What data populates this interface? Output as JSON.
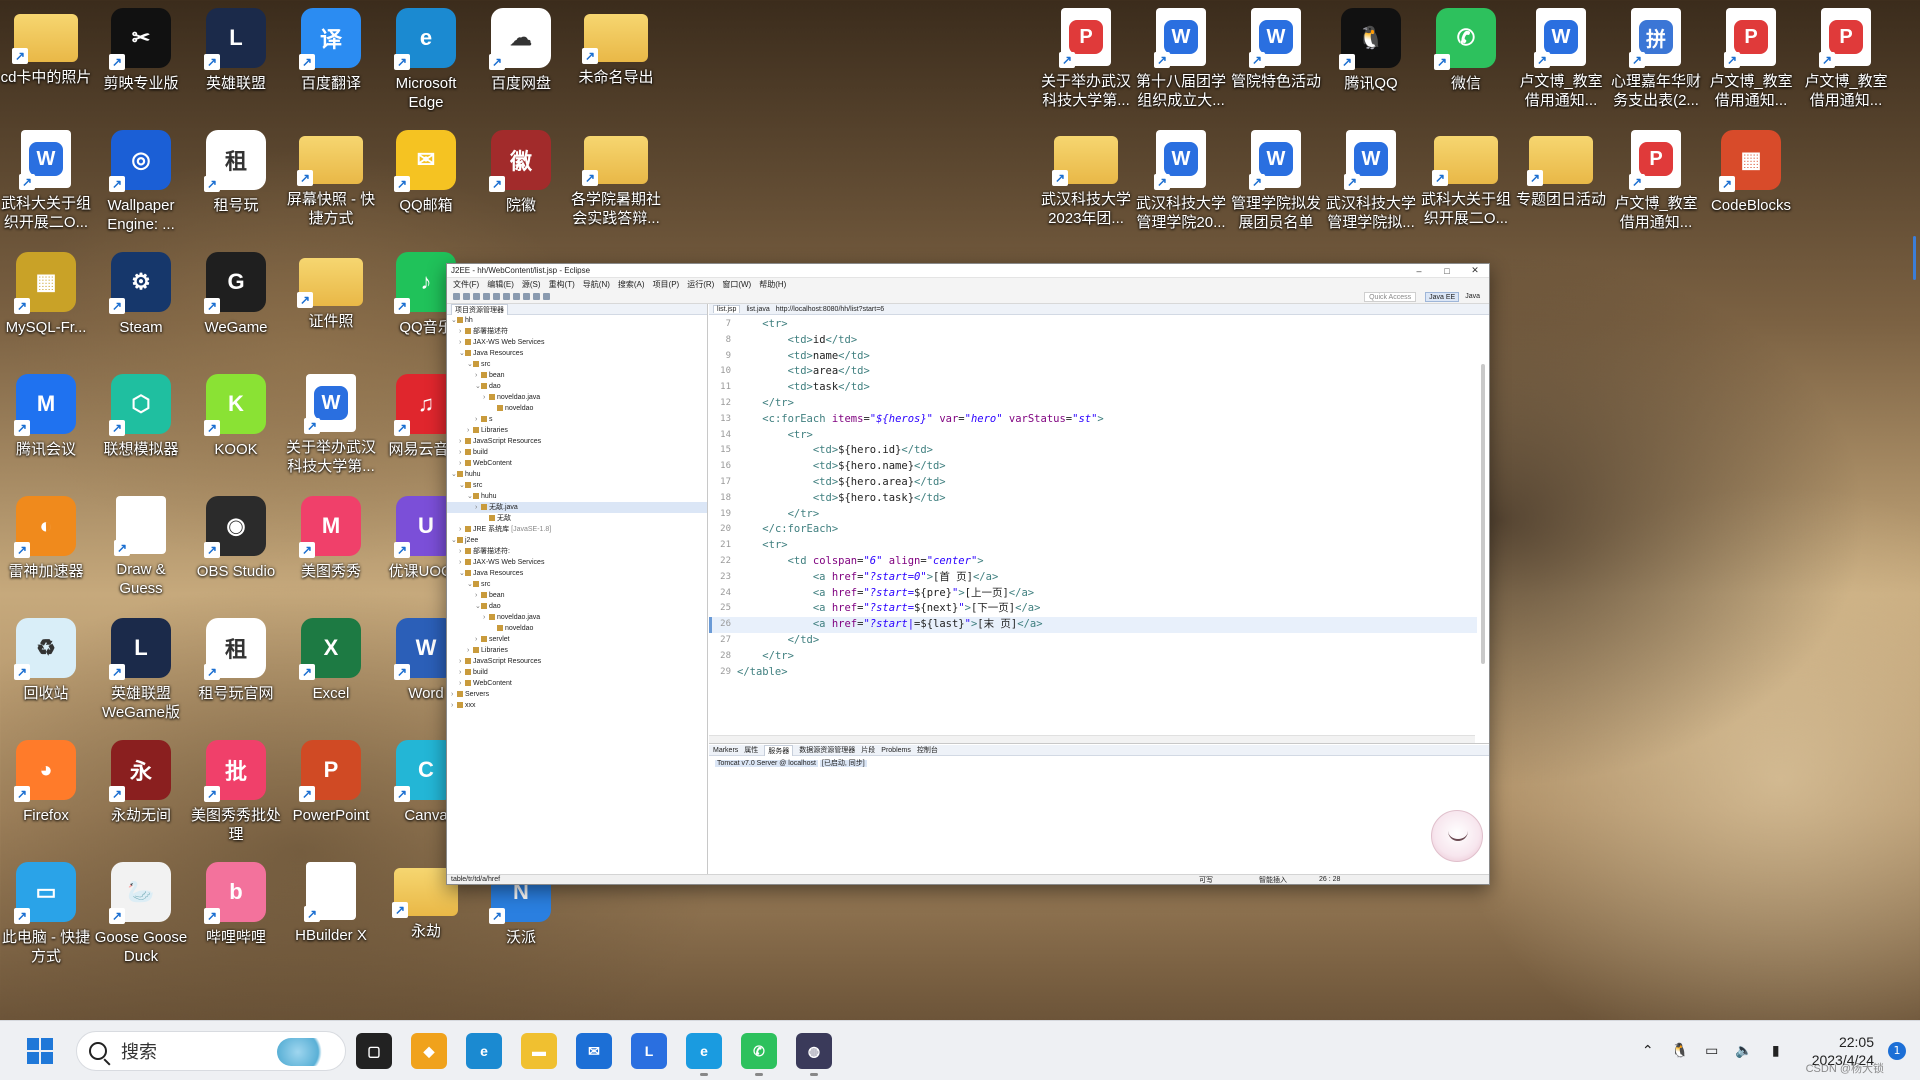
{
  "desktop": {
    "icons": [
      {
        "label": "cd卡中的照片",
        "icon": "photo-folder-icon",
        "color": "#e9b847",
        "kind": "folder"
      },
      {
        "label": "剪映专业版",
        "icon": "capcut-icon",
        "color": "#111111",
        "kind": "app",
        "glyph": "✂"
      },
      {
        "label": "英雄联盟",
        "icon": "league-of-legends-icon",
        "color": "#1b2a4a",
        "kind": "app",
        "glyph": "L"
      },
      {
        "label": "百度翻译",
        "icon": "baidu-translate-icon",
        "color": "#2b8cf2",
        "kind": "app",
        "glyph": "译"
      },
      {
        "label": "Microsoft Edge",
        "icon": "edge-icon",
        "color": "#1b8ad1",
        "kind": "app",
        "glyph": "e"
      },
      {
        "label": "百度网盘",
        "icon": "baidu-netdisk-icon",
        "color": "#ffffff",
        "kind": "app",
        "glyph": "☁"
      },
      {
        "label": "未命名导出",
        "icon": "folder-icon",
        "color": "#e9b847",
        "kind": "folder"
      },
      {
        "label": "武科大关于组织开展二O...",
        "icon": "wps-doc-icon",
        "color": "#2a6fe0",
        "kind": "doc",
        "glyph": "W"
      },
      {
        "label": "Wallpaper Engine: ...",
        "icon": "wallpaper-engine-icon",
        "color": "#1b5fd6",
        "kind": "app",
        "glyph": "◎"
      },
      {
        "label": "租号玩",
        "icon": "zuhaowan-icon",
        "color": "#ffffff",
        "kind": "app",
        "glyph": "租"
      },
      {
        "label": "屏幕快照 - 快捷方式",
        "icon": "screenshot-folder-icon",
        "color": "#e9b847",
        "kind": "folder"
      },
      {
        "label": "QQ邮箱",
        "icon": "qq-mail-icon",
        "color": "#f5c322",
        "kind": "app",
        "glyph": "✉"
      },
      {
        "label": "院徽",
        "icon": "college-emblem-icon",
        "color": "#a22b2b",
        "kind": "app",
        "glyph": "徽"
      },
      {
        "label": "各学院暑期社会实践答辩...",
        "icon": "zip-folder-icon",
        "color": "#e9b847",
        "kind": "folder"
      },
      {
        "label": "MySQL-Fr...",
        "icon": "mysql-icon",
        "color": "#c9a227",
        "kind": "app",
        "glyph": "▦"
      },
      {
        "label": "Steam",
        "icon": "steam-icon",
        "color": "#16376b",
        "kind": "app",
        "glyph": "⚙"
      },
      {
        "label": "WeGame",
        "icon": "wegame-icon",
        "color": "#1f1f1f",
        "kind": "app",
        "glyph": "G"
      },
      {
        "label": "证件照",
        "icon": "id-photo-folder-icon",
        "color": "#e9b847",
        "kind": "folder"
      },
      {
        "label": "QQ音乐",
        "icon": "qq-music-icon",
        "color": "#20c25a",
        "kind": "app",
        "glyph": "♪"
      },
      {
        "label": "腾讯会议",
        "icon": "tencent-meeting-icon",
        "color": "#1f72f0",
        "kind": "app",
        "glyph": "M"
      },
      {
        "label": "联想模拟器",
        "icon": "lenovo-emulator-icon",
        "color": "#1fbfa0",
        "kind": "app",
        "glyph": "⬡"
      },
      {
        "label": "KOOK",
        "icon": "kook-icon",
        "color": "#8ae234",
        "kind": "app",
        "glyph": "K"
      },
      {
        "label": "关于举办武汉科技大学第...",
        "icon": "wps-doc-icon",
        "color": "#2a6fe0",
        "kind": "doc",
        "glyph": "W"
      },
      {
        "label": "网易云音乐",
        "icon": "netease-music-icon",
        "color": "#e0262d",
        "kind": "app",
        "glyph": "♫"
      },
      {
        "label": "雷神加速器",
        "icon": "leishen-accelerator-icon",
        "color": "#f08a1c",
        "kind": "app",
        "glyph": "◐"
      },
      {
        "label": "Draw & Guess",
        "icon": "blank-file-icon",
        "color": "#ffffff",
        "kind": "doc",
        "glyph": ""
      },
      {
        "label": "OBS Studio",
        "icon": "obs-icon",
        "color": "#2b2b2b",
        "kind": "app",
        "glyph": "◉"
      },
      {
        "label": "美图秀秀",
        "icon": "meitu-icon",
        "color": "#f0406a",
        "kind": "app",
        "glyph": "M"
      },
      {
        "label": "优课UOOC",
        "icon": "uooc-icon",
        "color": "#7b4fd8",
        "kind": "app",
        "glyph": "U"
      },
      {
        "label": "回收站",
        "icon": "recycle-bin-icon",
        "color": "#d9eef8",
        "kind": "app",
        "glyph": "♻"
      },
      {
        "label": "英雄联盟WeGame版",
        "icon": "league-of-legends-icon",
        "color": "#1b2a4a",
        "kind": "app",
        "glyph": "L"
      },
      {
        "label": "租号玩官网",
        "icon": "zuhaowan-icon",
        "color": "#ffffff",
        "kind": "app",
        "glyph": "租"
      },
      {
        "label": "Excel",
        "icon": "excel-icon",
        "color": "#1d7a43",
        "kind": "app",
        "glyph": "X"
      },
      {
        "label": "Word",
        "icon": "word-icon",
        "color": "#2b5fb8",
        "kind": "app",
        "glyph": "W"
      },
      {
        "label": "Firefox",
        "icon": "firefox-icon",
        "color": "#ff7b2a",
        "kind": "app",
        "glyph": "◕"
      },
      {
        "label": "永劫无间",
        "icon": "naraka-icon",
        "color": "#8a1f1f",
        "kind": "app",
        "glyph": "永"
      },
      {
        "label": "美图秀秀批处理",
        "icon": "meitu-batch-icon",
        "color": "#f0406a",
        "kind": "app",
        "glyph": "批"
      },
      {
        "label": "PowerPoint",
        "icon": "powerpoint-icon",
        "color": "#d04a24",
        "kind": "app",
        "glyph": "P"
      },
      {
        "label": "Canva",
        "icon": "canva-icon",
        "color": "#23b6d6",
        "kind": "app",
        "glyph": "C"
      },
      {
        "label": "此电脑 - 快捷方式",
        "icon": "this-pc-icon",
        "color": "#2aa3e8",
        "kind": "app",
        "glyph": "▭"
      },
      {
        "label": "Goose Goose Duck",
        "icon": "goose-goose-duck-icon",
        "color": "#f2f2f2",
        "kind": "app",
        "glyph": "🦢"
      },
      {
        "label": "哔哩哔哩",
        "icon": "bilibili-icon",
        "color": "#f3729c",
        "kind": "app",
        "glyph": "b"
      },
      {
        "label": "HBuilder X",
        "icon": "blank-file-icon",
        "color": "#ffffff",
        "kind": "doc",
        "glyph": ""
      },
      {
        "label": "永劫",
        "icon": "folder-icon",
        "color": "#e9b847",
        "kind": "folder"
      },
      {
        "label": "沃派",
        "icon": "wopai-icon",
        "color": "#2a7fe0",
        "kind": "app",
        "glyph": "N"
      },
      {
        "label": "关于举办武汉科技大学第...",
        "icon": "wps-pdf-icon",
        "color": "#e03a3a",
        "kind": "doc",
        "glyph": "P"
      },
      {
        "label": "第十八届团学组织成立大...",
        "icon": "wps-doc-icon",
        "color": "#2a6fe0",
        "kind": "doc",
        "glyph": "W"
      },
      {
        "label": "管院特色活动",
        "icon": "wps-doc-icon",
        "color": "#2a6fe0",
        "kind": "doc",
        "glyph": "W"
      },
      {
        "label": "腾讯QQ",
        "icon": "qq-icon",
        "color": "#111111",
        "kind": "app",
        "glyph": "🐧"
      },
      {
        "label": "微信",
        "icon": "wechat-icon",
        "color": "#2dc15d",
        "kind": "app",
        "glyph": "✆"
      },
      {
        "label": "卢文博_教室借用通知...",
        "icon": "wps-doc-icon",
        "color": "#2a6fe0",
        "kind": "doc",
        "glyph": "W"
      },
      {
        "label": "心理嘉年华财务支出表(2...",
        "icon": "spreadsheet-icon",
        "color": "#3b76d6",
        "kind": "doc",
        "glyph": "拼"
      },
      {
        "label": "卢文博_教室借用通知...",
        "icon": "wps-pdf-icon",
        "color": "#e03a3a",
        "kind": "doc",
        "glyph": "P"
      },
      {
        "label": "卢文博_教室借用通知...",
        "icon": "wps-pdf-icon",
        "color": "#e03a3a",
        "kind": "doc",
        "glyph": "P"
      },
      {
        "label": "武汉科技大学2023年团...",
        "icon": "folder-icon",
        "color": "#e9b847",
        "kind": "folder"
      },
      {
        "label": "武汉科技大学管理学院20...",
        "icon": "wps-doc-icon",
        "color": "#2a6fe0",
        "kind": "doc",
        "glyph": "W"
      },
      {
        "label": "管理学院拟发展团员名单",
        "icon": "wps-doc-icon",
        "color": "#2a6fe0",
        "kind": "doc",
        "glyph": "W"
      },
      {
        "label": "武汉科技大学管理学院拟...",
        "icon": "wps-doc-icon",
        "color": "#2a6fe0",
        "kind": "doc",
        "glyph": "W"
      },
      {
        "label": "武科大关于组织开展二O...",
        "icon": "zip-folder-icon",
        "color": "#e9b847",
        "kind": "folder"
      },
      {
        "label": "专题团日活动",
        "icon": "zip-folder-icon",
        "color": "#e9b847",
        "kind": "folder"
      },
      {
        "label": "卢文博_教室借用通知...",
        "icon": "wps-pdf-icon",
        "color": "#e03a3a",
        "kind": "doc",
        "glyph": "P"
      },
      {
        "label": "CodeBlocks",
        "icon": "codeblocks-icon",
        "color": "#d84b2a",
        "kind": "app",
        "glyph": "▦"
      }
    ]
  },
  "eclipse": {
    "title": "J2EE - hh/WebContent/list.jsp - Eclipse",
    "menu": [
      "文件(F)",
      "编辑(E)",
      "源(S)",
      "重构(T)",
      "导航(N)",
      "搜索(A)",
      "项目(P)",
      "运行(R)",
      "窗口(W)",
      "帮助(H)"
    ],
    "quick_access": "Quick Access",
    "perspectives": [
      "Java EE",
      "Java"
    ],
    "explorer_tab": "项目资源管理器",
    "tree": [
      {
        "text": "hh",
        "indent": 0,
        "twisty": "⌄"
      },
      {
        "text": "部署描述符",
        "indent": 1,
        "twisty": "›"
      },
      {
        "text": "JAX-WS Web Services",
        "indent": 1,
        "twisty": "›"
      },
      {
        "text": "Java Resources",
        "indent": 1,
        "twisty": "⌄"
      },
      {
        "text": "src",
        "indent": 2,
        "twisty": "⌄"
      },
      {
        "text": "bean",
        "indent": 3,
        "twisty": "›"
      },
      {
        "text": "dao",
        "indent": 3,
        "twisty": "⌄"
      },
      {
        "text": "noveldao.java",
        "indent": 4,
        "twisty": "›"
      },
      {
        "text": "noveldao",
        "indent": 5,
        "twisty": ""
      },
      {
        "text": "s",
        "indent": 3,
        "twisty": "›"
      },
      {
        "text": "Libraries",
        "indent": 2,
        "twisty": "›"
      },
      {
        "text": "JavaScript Resources",
        "indent": 1,
        "twisty": "›"
      },
      {
        "text": "build",
        "indent": 1,
        "twisty": "›"
      },
      {
        "text": "WebContent",
        "indent": 1,
        "twisty": "›"
      },
      {
        "text": "huhu",
        "indent": 0,
        "twisty": "⌄"
      },
      {
        "text": "src",
        "indent": 1,
        "twisty": "⌄"
      },
      {
        "text": "huhu",
        "indent": 2,
        "twisty": "⌄"
      },
      {
        "text": "无敌.java",
        "indent": 3,
        "twisty": "›",
        "selected": true
      },
      {
        "text": "无敌",
        "indent": 4,
        "twisty": ""
      },
      {
        "text": "JRE 系统库",
        "indent": 1,
        "twisty": "›",
        "suffix": "[JavaSE-1.8]"
      },
      {
        "text": "j2ee",
        "indent": 0,
        "twisty": "⌄"
      },
      {
        "text": "部署描述符:",
        "indent": 1,
        "twisty": "›"
      },
      {
        "text": "JAX-WS Web Services",
        "indent": 1,
        "twisty": "›"
      },
      {
        "text": "Java Resources",
        "indent": 1,
        "twisty": "⌄"
      },
      {
        "text": "src",
        "indent": 2,
        "twisty": "⌄"
      },
      {
        "text": "bean",
        "indent": 3,
        "twisty": "›"
      },
      {
        "text": "dao",
        "indent": 3,
        "twisty": "⌄"
      },
      {
        "text": "noveldao.java",
        "indent": 4,
        "twisty": "›"
      },
      {
        "text": "noveldao",
        "indent": 5,
        "twisty": ""
      },
      {
        "text": "servlet",
        "indent": 3,
        "twisty": "›"
      },
      {
        "text": "Libraries",
        "indent": 2,
        "twisty": "›"
      },
      {
        "text": "JavaScript Resources",
        "indent": 1,
        "twisty": "›"
      },
      {
        "text": "build",
        "indent": 1,
        "twisty": "›"
      },
      {
        "text": "WebContent",
        "indent": 1,
        "twisty": "›"
      },
      {
        "text": "Servers",
        "indent": 0,
        "twisty": "›"
      },
      {
        "text": "xxx",
        "indent": 0,
        "twisty": "›"
      }
    ],
    "editor_tabs": [
      "list.jsp",
      "list.java",
      "http://localhost:8080/hh/list?start=6"
    ],
    "code": [
      {
        "n": "7",
        "html": "    <span class='tg'>&lt;tr&gt;</span>"
      },
      {
        "n": "8",
        "html": "        <span class='tg'>&lt;td&gt;</span>id<span class='tg'>&lt;/td&gt;</span>"
      },
      {
        "n": "9",
        "html": "        <span class='tg'>&lt;td&gt;</span>name<span class='tg'>&lt;/td&gt;</span>"
      },
      {
        "n": "10",
        "html": "        <span class='tg'>&lt;td&gt;</span>area<span class='tg'>&lt;/td&gt;</span>"
      },
      {
        "n": "11",
        "html": "        <span class='tg'>&lt;td&gt;</span>task<span class='tg'>&lt;/td&gt;</span>"
      },
      {
        "n": "12",
        "html": "    <span class='tg'>&lt;/tr&gt;</span>"
      },
      {
        "n": "13",
        "html": "    <span class='tg'>&lt;c:forEach</span> <span class='at'>items</span>=<span class='av'>\"${heros}\"</span> <span class='at'>var</span>=<span class='av'>\"hero\"</span> <span class='at'>varStatus</span>=<span class='av'>\"st\"</span><span class='tg'>&gt;</span>"
      },
      {
        "n": "14",
        "html": "        <span class='tg'>&lt;tr&gt;</span>"
      },
      {
        "n": "15",
        "html": "            <span class='tg'>&lt;td&gt;</span>${hero.id}<span class='tg'>&lt;/td&gt;</span>"
      },
      {
        "n": "16",
        "html": "            <span class='tg'>&lt;td&gt;</span>${hero.name}<span class='tg'>&lt;/td&gt;</span>"
      },
      {
        "n": "17",
        "html": "            <span class='tg'>&lt;td&gt;</span>${hero.area}<span class='tg'>&lt;/td&gt;</span>"
      },
      {
        "n": "18",
        "html": "            <span class='tg'>&lt;td&gt;</span>${hero.task}<span class='tg'>&lt;/td&gt;</span>"
      },
      {
        "n": "19",
        "html": "        <span class='tg'>&lt;/tr&gt;</span>"
      },
      {
        "n": "20",
        "html": "    <span class='tg'>&lt;/c:forEach&gt;</span>"
      },
      {
        "n": "21",
        "html": "    <span class='tg'>&lt;tr&gt;</span>"
      },
      {
        "n": "22",
        "html": "        <span class='tg'>&lt;td</span> <span class='at'>colspan</span>=<span class='av'>\"6\"</span> <span class='at'>align</span>=<span class='av'>\"center\"</span><span class='tg'>&gt;</span>"
      },
      {
        "n": "23",
        "html": "            <span class='tg'>&lt;a</span> <span class='at'>href</span>=<span class='av'>\"?start=0\"</span><span class='tg'>&gt;</span>[首 页]<span class='tg'>&lt;/a&gt;</span>"
      },
      {
        "n": "24",
        "html": "            <span class='tg'>&lt;a</span> <span class='at'>href</span>=<span class='av'>\"?start=</span>${pre}<span class='av'>\"</span><span class='tg'>&gt;</span>[上一页]<span class='tg'>&lt;/a&gt;</span>"
      },
      {
        "n": "25",
        "html": "            <span class='tg'>&lt;a</span> <span class='at'>href</span>=<span class='av'>\"?start=</span>${next}<span class='av'>\"</span><span class='tg'>&gt;</span>[下一页]<span class='tg'>&lt;/a&gt;</span>"
      },
      {
        "n": "26",
        "html": "            <span class='tg'>&lt;a</span> <span class='at'>href</span>=<span class='av'>\"?start|</span>=${last}<span class='av'>\"</span><span class='tg'>&gt;</span>[末 页]<span class='tg'>&lt;/a&gt;</span>",
        "current": true
      },
      {
        "n": "27",
        "html": "        <span class='tg'>&lt;/td&gt;</span>"
      },
      {
        "n": "28",
        "html": "    <span class='tg'>&lt;/tr&gt;</span>"
      },
      {
        "n": "29",
        "html": "<span class='tg'>&lt;/table&gt;</span>"
      }
    ],
    "bottom_tabs": [
      "Markers",
      "属性",
      "服务器",
      "数据源资源管理器",
      "片段",
      "Problems",
      "控制台"
    ],
    "server_entry": "Tomcat v7.0 Server @ localhost",
    "server_state": "[已启动, 同步]",
    "status": {
      "path": "table/tr/td/a/href",
      "writable": "可写",
      "insert": "智能插入",
      "pos": "26 : 28"
    }
  },
  "taskbar": {
    "search_placeholder": "搜索",
    "apps": [
      {
        "name": "task-view-icon",
        "color": "#222222",
        "glyph": "▢"
      },
      {
        "name": "widgets-icon",
        "color": "#f0a21c",
        "glyph": "◆"
      },
      {
        "name": "edge-taskbar-icon",
        "color": "#1b8ad1",
        "glyph": "e"
      },
      {
        "name": "file-explorer-icon",
        "color": "#f0c030",
        "glyph": "▬"
      },
      {
        "name": "mail-icon",
        "color": "#1c6fd6",
        "glyph": "✉"
      },
      {
        "name": "lenovo-vantage-icon",
        "color": "#2a6fe0",
        "glyph": "L"
      },
      {
        "name": "ie-icon",
        "color": "#1a9be0",
        "glyph": "e"
      },
      {
        "name": "wechat-taskbar-icon",
        "color": "#2dc15d",
        "glyph": "✆"
      },
      {
        "name": "eclipse-taskbar-icon",
        "color": "#3a3a5a",
        "glyph": "◍"
      }
    ],
    "time": "22:05",
    "date": "2023/4/24",
    "notifications": "1",
    "watermark": "CSDN @杨大锁"
  }
}
